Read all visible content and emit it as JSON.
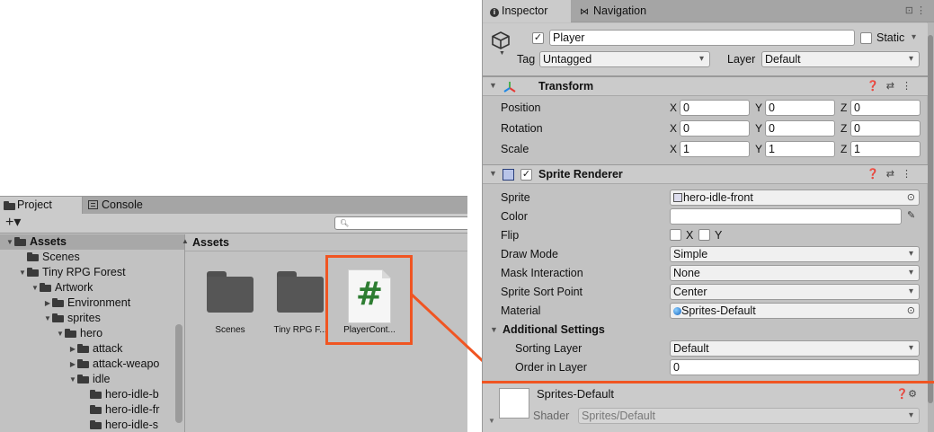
{
  "colors": {
    "highlight": "#f05522",
    "script_hash": "#2e7d32",
    "panel_bg": "#c2c2c2"
  },
  "project": {
    "tabs": [
      {
        "label": "Project",
        "icon": "folder-icon"
      },
      {
        "label": "Console",
        "icon": "console-icon"
      }
    ],
    "create_label": "+▾",
    "search_placeholder": "",
    "tree": [
      {
        "label": "Assets",
        "depth": 0,
        "arrow": "▼",
        "selected": true
      },
      {
        "label": "Scenes",
        "depth": 1,
        "arrow": ""
      },
      {
        "label": "Tiny RPG Forest",
        "depth": 1,
        "arrow": "▼"
      },
      {
        "label": "Artwork",
        "depth": 2,
        "arrow": "▼"
      },
      {
        "label": "Environment",
        "depth": 3,
        "arrow": "▶"
      },
      {
        "label": "sprites",
        "depth": 3,
        "arrow": "▼"
      },
      {
        "label": "hero",
        "depth": 4,
        "arrow": "▼"
      },
      {
        "label": "attack",
        "depth": 5,
        "arrow": "▶"
      },
      {
        "label": "attack-weapo",
        "depth": 5,
        "arrow": "▶"
      },
      {
        "label": "idle",
        "depth": 5,
        "arrow": "▼"
      },
      {
        "label": "hero-idle-b",
        "depth": 6,
        "arrow": ""
      },
      {
        "label": "hero-idle-fr",
        "depth": 6,
        "arrow": ""
      },
      {
        "label": "hero-idle-s",
        "depth": 6,
        "arrow": ""
      }
    ],
    "assets_title": "Assets",
    "assets": [
      {
        "label": "Scenes",
        "kind": "folder"
      },
      {
        "label": "Tiny RPG F...",
        "kind": "folder"
      },
      {
        "label": "PlayerCont...",
        "kind": "script"
      }
    ]
  },
  "inspector": {
    "tabs": [
      {
        "label": "Inspector",
        "icon": "info-icon"
      },
      {
        "label": "Navigation",
        "icon": "navigation-icon"
      }
    ],
    "object_name": "Player",
    "static_label": "Static",
    "tag_label": "Tag",
    "tag_value": "Untagged",
    "layer_label": "Layer",
    "layer_value": "Default",
    "transform": {
      "title": "Transform",
      "rows": [
        {
          "label": "Position",
          "x": "0",
          "y": "0",
          "z": "0"
        },
        {
          "label": "Rotation",
          "x": "0",
          "y": "0",
          "z": "0"
        },
        {
          "label": "Scale",
          "x": "1",
          "y": "1",
          "z": "1"
        }
      ]
    },
    "sprite_renderer": {
      "title": "Sprite Renderer",
      "sprite_label": "Sprite",
      "sprite_value": "hero-idle-front",
      "color_label": "Color",
      "flip_label": "Flip",
      "flip_x": "X",
      "flip_y": "Y",
      "draw_mode_label": "Draw Mode",
      "draw_mode_value": "Simple",
      "mask_label": "Mask Interaction",
      "mask_value": "None",
      "sort_point_label": "Sprite Sort Point",
      "sort_point_value": "Center",
      "material_label": "Material",
      "material_value": "Sprites-Default",
      "additional_label": "Additional Settings",
      "sorting_layer_label": "Sorting Layer",
      "sorting_layer_value": "Default",
      "order_label": "Order in Layer",
      "order_value": "0"
    },
    "material": {
      "name": "Sprites-Default",
      "shader_label": "Shader",
      "shader_value": "Sprites/Default"
    }
  }
}
